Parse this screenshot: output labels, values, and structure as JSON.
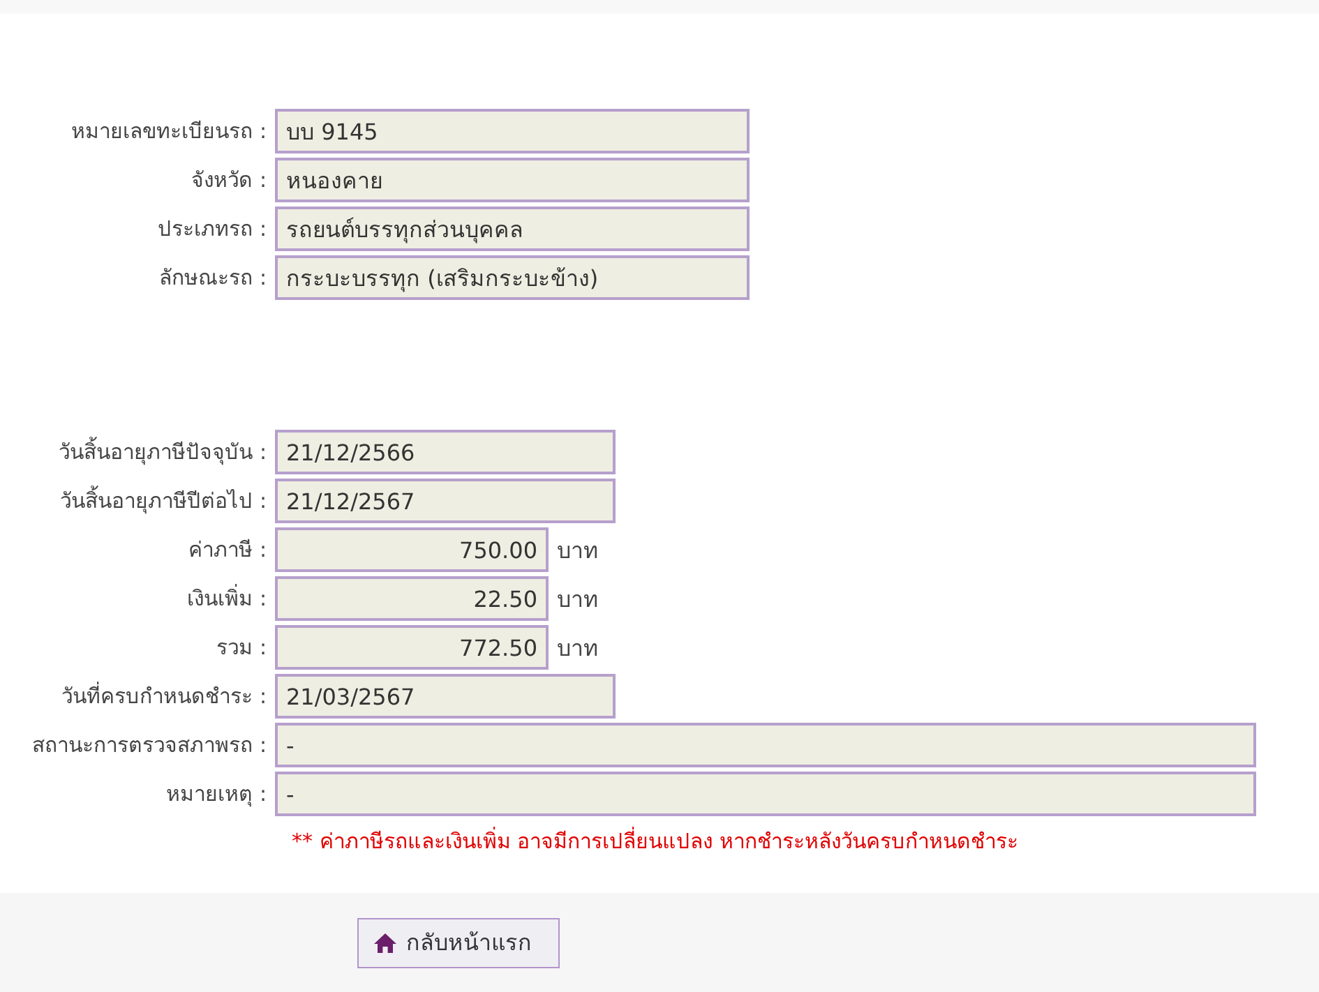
{
  "vehicle_fields": [
    {
      "label": "หมายเลขทะเบียนรถ :",
      "kind": "text",
      "value": "บบ 9145"
    },
    {
      "label": "จังหวัด :",
      "kind": "text",
      "value": "หนองคาย"
    },
    {
      "label": "ประเภทรถ :",
      "kind": "text",
      "value": "รถยนต์บรรทุกส่วนบุคคล"
    },
    {
      "label": "ลักษณะรถ :",
      "kind": "text",
      "value": "กระบะบรรทุก (เสริมกระบะข้าง)"
    }
  ],
  "tax_fields": [
    {
      "label": "วันสิ้นอายุภาษีปัจจุบัน :",
      "kind": "date",
      "value": "21/12/2566"
    },
    {
      "label": "วันสิ้นอายุภาษีปีต่อไป :",
      "kind": "date",
      "value": "21/12/2567"
    },
    {
      "label": "ค่าภาษี :",
      "kind": "amount",
      "value": "750.00",
      "unit": "บาท"
    },
    {
      "label": "เงินเพิ่ม :",
      "kind": "amount",
      "value": "22.50",
      "unit": "บาท"
    },
    {
      "label": "รวม :",
      "kind": "amount",
      "value": "772.50",
      "unit": "บาท"
    },
    {
      "label": "วันที่ครบกำหนดชำระ :",
      "kind": "date",
      "value": "21/03/2567"
    },
    {
      "label": "สถานะการตรวจสภาพรถ :",
      "kind": "long",
      "value": "-"
    },
    {
      "label": "หมายเหตุ :",
      "kind": "long",
      "value": "-"
    }
  ],
  "notice": "** ค่าภาษีรถและเงินเพิ่ม อาจมีการเปลี่ยนแปลง หากชำระหลังวันครบกำหนดชำระ",
  "home_button": {
    "label": "กลับหน้าแรก"
  }
}
